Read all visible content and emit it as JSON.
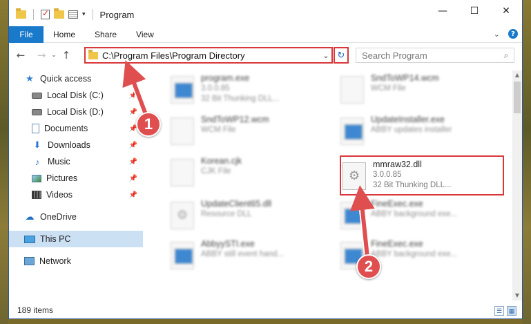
{
  "window": {
    "title": "Program",
    "minimize": "—",
    "maximize": "☐",
    "close": "✕"
  },
  "ribbon": {
    "tabs": [
      "File",
      "Home",
      "Share",
      "View"
    ]
  },
  "navigation": {
    "back": "←",
    "forward": "→",
    "recent": "⌄",
    "up": "↑",
    "address": "C:\\Program Files\\Program Directory",
    "dropdown": "⌄",
    "refresh": "↻",
    "search_placeholder": "Search Program",
    "search_icon": "⌕"
  },
  "sidebar": {
    "items": [
      {
        "label": "Quick access",
        "icon": "star-icon",
        "level": 0,
        "pinned": false
      },
      {
        "label": "Local Disk (C:)",
        "icon": "local-disk-icon",
        "level": 1,
        "pinned": true
      },
      {
        "label": "Local Disk (D:)",
        "icon": "local-disk-icon",
        "level": 1,
        "pinned": true
      },
      {
        "label": "Documents",
        "icon": "documents-icon",
        "level": 1,
        "pinned": true
      },
      {
        "label": "Downloads",
        "icon": "downloads-icon",
        "level": 1,
        "pinned": true
      },
      {
        "label": "Music",
        "icon": "music-icon",
        "level": 1,
        "pinned": true
      },
      {
        "label": "Pictures",
        "icon": "pictures-icon",
        "level": 1,
        "pinned": true
      },
      {
        "label": "Videos",
        "icon": "videos-icon",
        "level": 1,
        "pinned": true
      },
      {
        "label": "OneDrive",
        "icon": "onedrive-icon",
        "level": 0,
        "pinned": false
      },
      {
        "label": "This PC",
        "icon": "this-pc-icon",
        "level": 0,
        "pinned": false,
        "selected": true
      },
      {
        "label": "Network",
        "icon": "network-icon",
        "level": 0,
        "pinned": false
      }
    ]
  },
  "files": [
    {
      "name": "program.exe",
      "line2": "3.0.0.85",
      "line3": "32 Bit Thunking DLL...",
      "icon": "exe-file-icon"
    },
    {
      "name": "SndToWP14.wcm",
      "line2": "WCM File",
      "line3": "",
      "icon": "file-icon"
    },
    {
      "name": "SndToWP12.wcm",
      "line2": "WCM File",
      "line3": "",
      "icon": "file-icon"
    },
    {
      "name": "UpdateInstaller.exe",
      "line2": "ABBY updates installer",
      "line3": "",
      "icon": "exe-file-icon"
    },
    {
      "name": "Korean.cjk",
      "line2": "CJK File",
      "line3": "",
      "icon": "file-icon"
    },
    {
      "name": "mmraw32.dll",
      "line2": "3.0.0.85",
      "line3": "32 Bit Thunking DLL...",
      "icon": "dll-file-icon",
      "highlighted": true
    },
    {
      "name": "UpdateClient65.dll",
      "line2": "Resource DLL",
      "line3": "",
      "icon": "dll-file-icon"
    },
    {
      "name": "FineExec.exe",
      "line2": "ABBY background exe...",
      "line3": "",
      "icon": "exe-file-icon"
    },
    {
      "name": "AbbyySTI.exe",
      "line2": "ABBY still event hand...",
      "line3": "",
      "icon": "exe-file-icon"
    },
    {
      "name": "FineExec.exe",
      "line2": "ABBY background exe...",
      "line3": "",
      "icon": "exe-file-icon"
    }
  ],
  "status": {
    "count": "189 items"
  },
  "callouts": [
    "1",
    "2"
  ],
  "colors": {
    "accent": "#1979ca",
    "highlight_border": "#d9383a",
    "callout": "#e04f4f",
    "selected_bg": "#cce0f4"
  }
}
